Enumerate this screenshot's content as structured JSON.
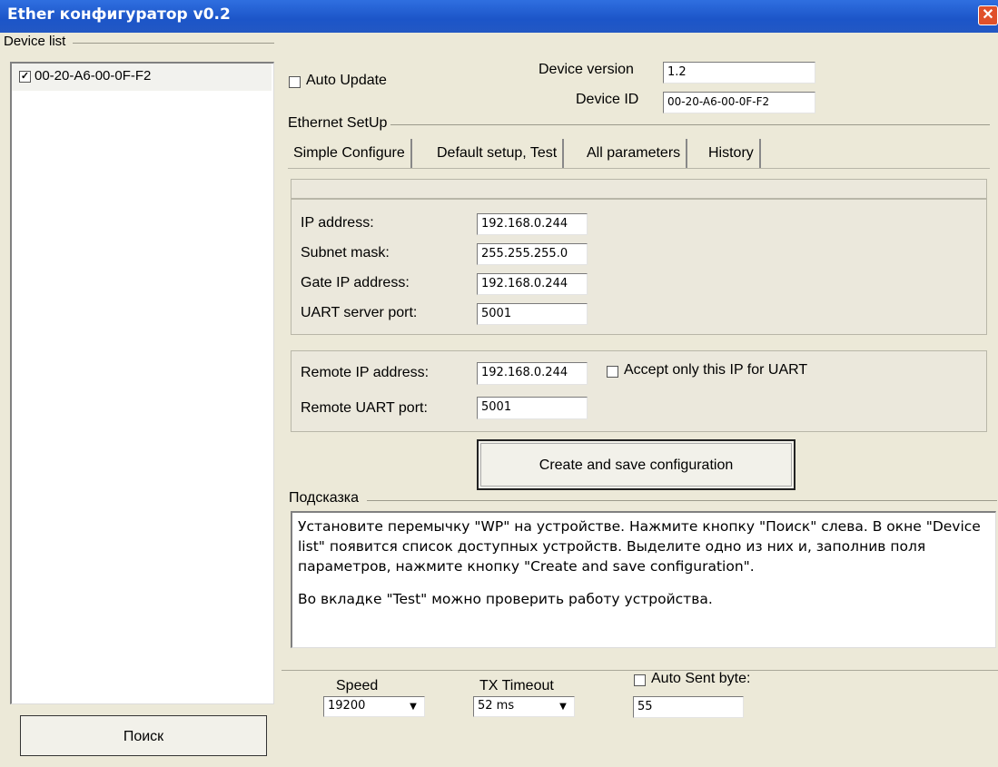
{
  "window": {
    "title": "Ether конфигуратор v0.2",
    "close_glyph": "✕"
  },
  "sidebar": {
    "group_label": "Device list",
    "devices": [
      {
        "label": "00-20-A6-00-0F-F2",
        "checked": true
      }
    ],
    "search_button": "Поиск"
  },
  "header": {
    "auto_update_label": "Auto Update",
    "device_version_label": "Device version",
    "device_version_value": "1.2",
    "device_id_label": "Device ID",
    "device_id_value": "00-20-A6-00-0F-F2"
  },
  "ethernet_group_label": "Ethernet SetUp",
  "tabs": [
    {
      "label": "Simple Configure",
      "active": true
    },
    {
      "label": "Default setup, Test",
      "active": false
    },
    {
      "label": "All parameters",
      "active": false
    },
    {
      "label": "History",
      "active": false
    }
  ],
  "network": {
    "ip_label": "IP address:",
    "ip_value": "192.168.0.244",
    "mask_label": "Subnet mask:",
    "mask_value": "255.255.255.0",
    "gate_label": "Gate IP address:",
    "gate_value": "192.168.0.244",
    "uart_port_label": "UART server port:",
    "uart_port_value": "5001"
  },
  "remote": {
    "ip_label": "Remote IP address:",
    "ip_value": "192.168.0.244",
    "accept_label": "Accept only this IP for UART",
    "port_label": "Remote UART port:",
    "port_value": "5001"
  },
  "create_button": "Create and save configuration",
  "hint": {
    "label": "Подсказка",
    "paragraph1": "Установите перемычку \"WP\" на устройстве. Нажмите кнопку \"Поиск\" слева. В окне \"Device list\" появится список доступных устройств. Выделите одно из них и, заполнив поля параметров, нажмите кнопку \"Create and save configuration\".",
    "paragraph2": "Во вкладке \"Test\" можно проверить работу устройства."
  },
  "bottom": {
    "speed_label": "Speed",
    "speed_value": "19200",
    "tx_timeout_label": "TX Timeout",
    "tx_timeout_value": "52 ms",
    "auto_sent_label": "Auto Sent byte:",
    "auto_sent_value": "55",
    "dropdown_glyph": "▼"
  }
}
